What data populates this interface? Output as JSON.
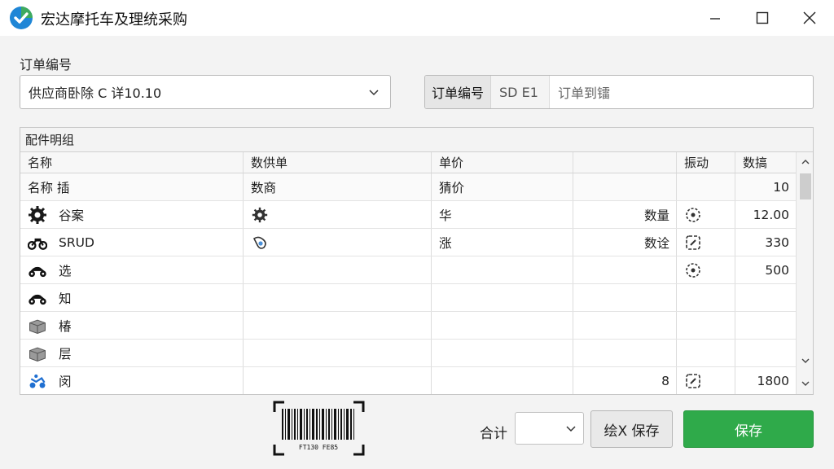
{
  "window": {
    "title": "宏达摩托车及理统采购",
    "controls": [
      "minimize",
      "maximize",
      "close"
    ]
  },
  "form": {
    "order_label": "订单编号",
    "supplier_value": "供应商卧除 C 详10.10",
    "order_box": {
      "label": "订单编号",
      "code": "SD E1",
      "status": "订单到镭"
    }
  },
  "grid": {
    "title": "配件明组",
    "headers": [
      "名称",
      "数供单",
      "单价",
      "",
      "振动",
      "数搞"
    ],
    "subheader": [
      "名称  插",
      "数商",
      "猜价",
      "",
      "",
      "10"
    ],
    "rows": [
      {
        "icon": "gear-icon",
        "name": "谷案",
        "supplier_icon": "gear-icon",
        "price": "华",
        "qty_label": "数量",
        "status_icon": "target-icon",
        "amount": "12.00"
      },
      {
        "icon": "motorcycle-icon",
        "name": "SRUD",
        "supplier_icon": "parts-icon",
        "price": "涨",
        "qty_label": "数诠",
        "status_icon": "edit-icon",
        "amount": "330"
      },
      {
        "icon": "motorcycle-icon",
        "name": "选",
        "supplier_icon": "",
        "price": "",
        "qty_label": "",
        "status_icon": "target-icon",
        "amount": "500"
      },
      {
        "icon": "motorcycle-icon",
        "name": "知",
        "supplier_icon": "",
        "price": "",
        "qty_label": "",
        "status_icon": "",
        "amount": ""
      },
      {
        "icon": "box-icon",
        "name": "椿",
        "supplier_icon": "",
        "price": "",
        "qty_label": "",
        "status_icon": "",
        "amount": ""
      },
      {
        "icon": "box-icon",
        "name": "层",
        "supplier_icon": "",
        "price": "",
        "qty_label": "",
        "status_icon": "",
        "amount": ""
      },
      {
        "icon": "rider-icon",
        "name": "闵",
        "supplier_icon": "",
        "price": "",
        "qty_label": "8",
        "status_icon": "edit-icon",
        "amount": "1800"
      }
    ]
  },
  "footer": {
    "barcode_text": "FT130 FE85",
    "total_label": "合计",
    "total_value": "",
    "draft_button": "绘X 保存",
    "save_button": "保存"
  },
  "colors": {
    "accent_green": "#2faa4a",
    "app_icon_blue": "#1f86d6",
    "app_icon_green": "#44b04a"
  }
}
